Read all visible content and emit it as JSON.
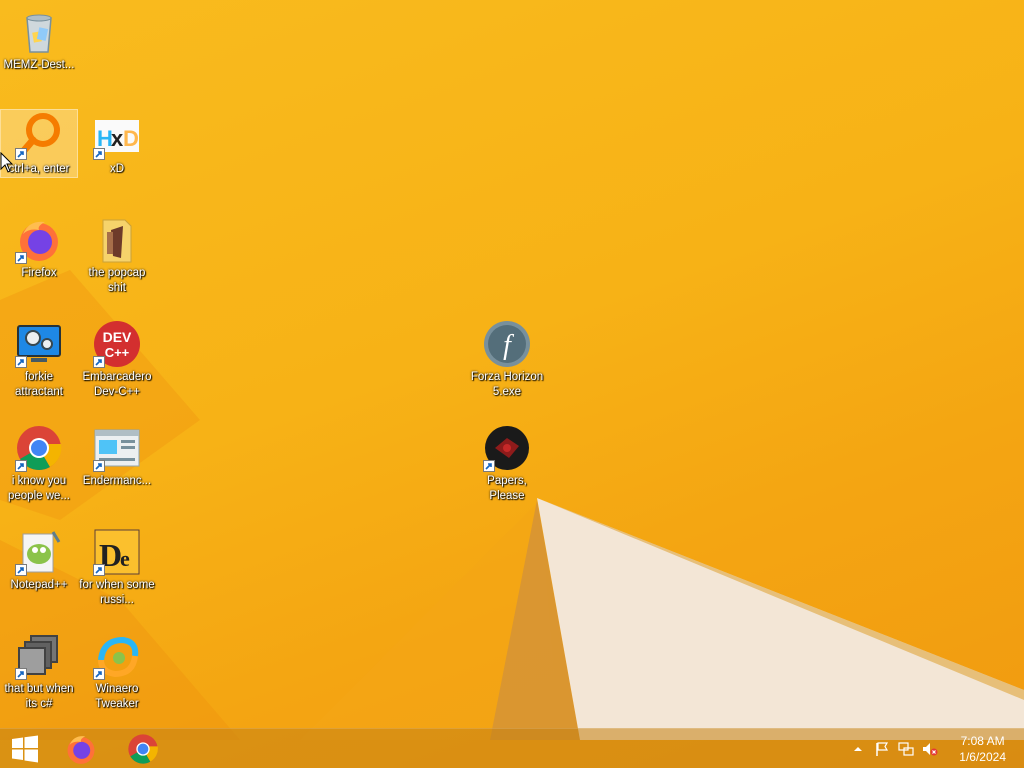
{
  "desktop": {
    "wallpaper": {
      "primary": "#f7b216",
      "shadow": "#e8900f",
      "light": "#f4e7d4"
    },
    "icons": [
      {
        "name": "recycle-bin",
        "label": "MEMZ-Dest...",
        "shortcut": false,
        "icon": "recycle-bin-icon"
      },
      {
        "name": "ctrl-a-enter",
        "label": "ctrl+a, enter",
        "shortcut": true,
        "icon": "search-magnifier-icon",
        "selected": true
      },
      {
        "name": "xd",
        "label": "xD",
        "shortcut": true,
        "icon": "hxd-icon"
      },
      {
        "name": "firefox",
        "label": "Firefox",
        "shortcut": true,
        "icon": "firefox-icon"
      },
      {
        "name": "the-popcap-shit",
        "label": "the popcap shit",
        "shortcut": false,
        "icon": "folder-icon"
      },
      {
        "name": "forkie-attractant",
        "label": "forkie attractant",
        "shortcut": true,
        "icon": "monitor-gears-icon"
      },
      {
        "name": "embarcadero-dev-cpp",
        "label": "Embarcadero Dev-C++",
        "shortcut": true,
        "icon": "devcpp-icon"
      },
      {
        "name": "forza-horizon-5",
        "label": "Forza Horizon 5.exe",
        "shortcut": false,
        "icon": "flash-icon"
      },
      {
        "name": "i-know-you-people",
        "label": "i know you people we...",
        "shortcut": true,
        "icon": "chrome-icon"
      },
      {
        "name": "endermanch",
        "label": "Endermanc...",
        "shortcut": true,
        "icon": "window-app-icon"
      },
      {
        "name": "papers-please",
        "label": "Papers, Please",
        "shortcut": true,
        "icon": "papers-please-icon"
      },
      {
        "name": "notepad-plus-plus",
        "label": "Notepad++",
        "shortcut": true,
        "icon": "notepadpp-icon"
      },
      {
        "name": "for-when-some-russi",
        "label": "for when some russi...",
        "shortcut": true,
        "icon": "de-icon"
      },
      {
        "name": "that-but-when-its-csharp",
        "label": "that but when its c#",
        "shortcut": true,
        "icon": "stacked-windows-icon"
      },
      {
        "name": "winaero-tweaker",
        "label": "Winaero Tweaker",
        "shortcut": true,
        "icon": "winaero-icon"
      }
    ]
  },
  "taskbar": {
    "start": "start-button",
    "pinned": [
      "firefox-icon",
      "chrome-icon"
    ],
    "tray": {
      "icons": [
        "show-hidden-icons-chevron",
        "action-center-flag-icon",
        "network-icon",
        "volume-muted-icon"
      ],
      "time": "7:08 AM",
      "date": "1/6/2024"
    }
  }
}
